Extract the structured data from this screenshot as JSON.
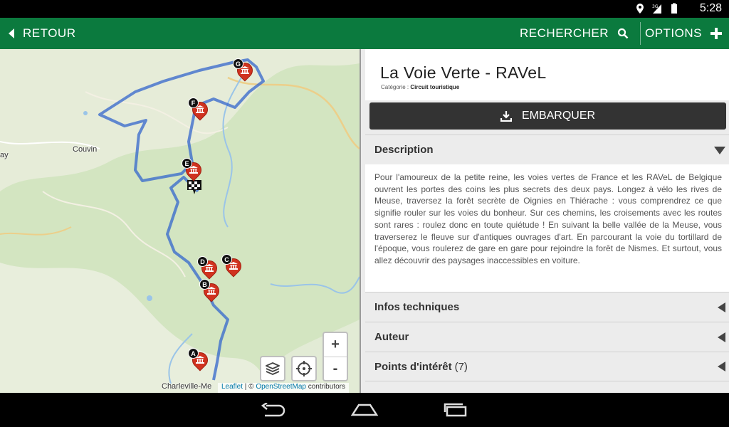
{
  "status": {
    "time": "5:28",
    "icons": [
      "location-icon",
      "signal-3g-icon",
      "battery-icon"
    ]
  },
  "appbar": {
    "back_label": "RETOUR",
    "search_label": "RECHERCHER",
    "options_label": "OPTIONS",
    "background": "#0b7a3e"
  },
  "map": {
    "places": [
      "Couvin",
      "ay",
      "Charleville-Me"
    ],
    "markers": [
      "A",
      "B",
      "C",
      "D",
      "E",
      "F",
      "G"
    ],
    "zoom_in": "+",
    "zoom_out": "-",
    "attribution": {
      "leaflet": "Leaflet",
      "separator": " | © ",
      "osm": "OpenStreetMap",
      "suffix": " contributors"
    }
  },
  "detail": {
    "title": "La Voie Verte - RAVeL",
    "category_label": "Catégorie :",
    "category_value": "Circuit touristique",
    "embark_label": "EMBARQUER",
    "description_header": "Description",
    "description": "Pour l'amoureux de la petite reine, les voies vertes de France et les RAVeL de Belgique ouvrent les portes des coins les plus secrets des deux pays. Longez à vélo les rives de Meuse, traversez la forêt secrète de Oignies en Thiérache : vous comprendrez ce que signifie rouler sur les voies du bonheur. Sur ces chemins, les croisements avec les routes sont rares : roulez donc en toute quiétude ! En suivant la belle vallée de la Meuse, vous traverserez le fleuve sur d'antiques ouvrages d'art. En parcourant la voie du tortillard de l'époque, vous roulerez de gare en gare pour rejoindre la forêt de Nismes. Et surtout, vous allez découvrir des paysages inaccessibles en voiture.",
    "sections": [
      {
        "label": "Infos techniques",
        "count": ""
      },
      {
        "label": "Auteur",
        "count": ""
      },
      {
        "label": "Points d'intérêt",
        "count": "(7)"
      }
    ]
  }
}
